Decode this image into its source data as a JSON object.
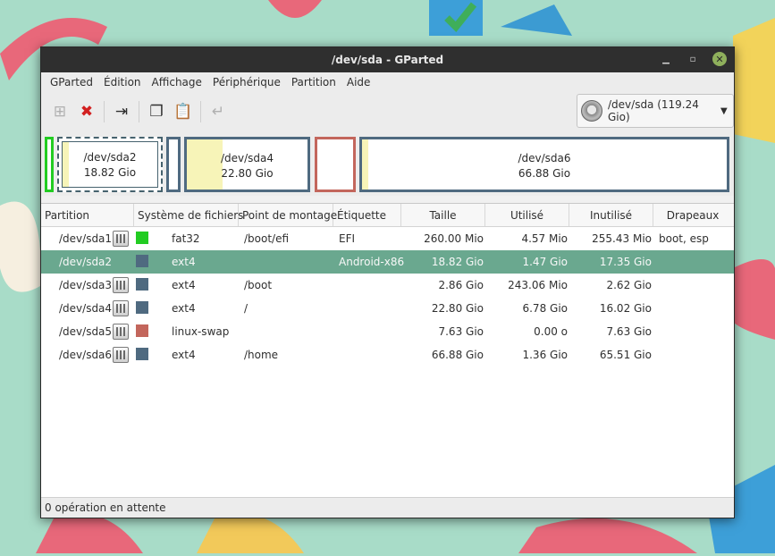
{
  "window": {
    "title": "/dev/sda - GParted"
  },
  "menu": [
    "GParted",
    "Édition",
    "Affichage",
    "Périphérique",
    "Partition",
    "Aide"
  ],
  "toolbar": {
    "icons": [
      "new-partition-icon",
      "delete-icon",
      "resize-move-icon",
      "copy-icon",
      "paste-icon",
      "undo-icon"
    ],
    "device_selector": "/dev/sda   (119.24 Gio)"
  },
  "diskmap": [
    {
      "name": "",
      "size": "",
      "color": "#22cc22",
      "used": 0.0
    },
    {
      "name": "/dev/sda2",
      "size": "18.82 Gio",
      "color": "#46626e",
      "used": 0.08
    },
    {
      "name": "",
      "size": "",
      "color": "#4f6a80",
      "used": 0.0
    },
    {
      "name": "/dev/sda4",
      "size": "22.80 Gio",
      "color": "#4f6a80",
      "used": 0.3
    },
    {
      "name": "",
      "size": "",
      "color": "#c3665c",
      "used": 0.0
    },
    {
      "name": "/dev/sda6",
      "size": "66.88 Gio",
      "color": "#4f6a80",
      "used": 0.02
    }
  ],
  "columns": [
    "Partition",
    "Système de fichiers",
    "Point de montage",
    "Étiquette",
    "Taille",
    "Utilisé",
    "Inutilisé",
    "Drapeaux"
  ],
  "rows": [
    {
      "partition": "/dev/sda1",
      "fs": "fat32",
      "fs_color": "#22cc22",
      "mount": "/boot/efi",
      "label": "EFI",
      "size": "260.00 Mio",
      "used": "4.57 Mio",
      "unused": "255.43 Mio",
      "flags": "boot, esp",
      "locked": true
    },
    {
      "partition": "/dev/sda2",
      "fs": "ext4",
      "fs_color": "#4f6a80",
      "mount": "",
      "label": "Android-x86",
      "size": "18.82 Gio",
      "used": "1.47 Gio",
      "unused": "17.35 Gio",
      "flags": "",
      "locked": false
    },
    {
      "partition": "/dev/sda3",
      "fs": "ext4",
      "fs_color": "#4f6a80",
      "mount": "/boot",
      "label": "",
      "size": "2.86 Gio",
      "used": "243.06 Mio",
      "unused": "2.62 Gio",
      "flags": "",
      "locked": true
    },
    {
      "partition": "/dev/sda4",
      "fs": "ext4",
      "fs_color": "#4f6a80",
      "mount": "/",
      "label": "",
      "size": "22.80 Gio",
      "used": "6.78 Gio",
      "unused": "16.02 Gio",
      "flags": "",
      "locked": true
    },
    {
      "partition": "/dev/sda5",
      "fs": "linux-swap",
      "fs_color": "#c3665c",
      "mount": "",
      "label": "",
      "size": "7.63 Gio",
      "used": "0.00 o",
      "unused": "7.63 Gio",
      "flags": "",
      "locked": true
    },
    {
      "partition": "/dev/sda6",
      "fs": "ext4",
      "fs_color": "#4f6a80",
      "mount": "/home",
      "label": "",
      "size": "66.88 Gio",
      "used": "1.36 Gio",
      "unused": "65.51 Gio",
      "flags": "",
      "locked": true
    }
  ],
  "selected_row": 1,
  "status": "0 opération en attente"
}
